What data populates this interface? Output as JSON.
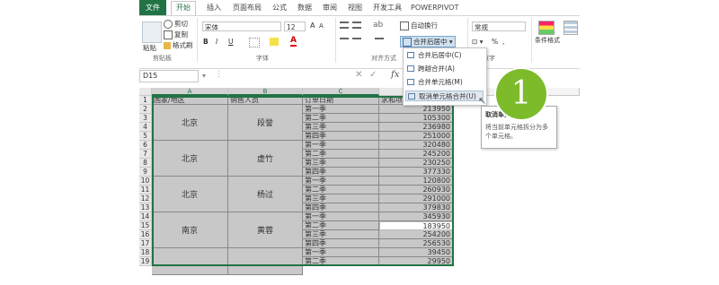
{
  "ribbon_tabs": [
    "文件",
    "开始",
    "插入",
    "页面布局",
    "公式",
    "数据",
    "审阅",
    "视图",
    "开发工具",
    "POWERPIVOT"
  ],
  "clipboard": {
    "paste": "粘贴",
    "cut": "剪切",
    "copy": "复制",
    "format_painter": "格式刷",
    "label": "剪贴板"
  },
  "font": {
    "name": "宋体",
    "size": "12",
    "bold": "B",
    "italic": "I",
    "underline": "U",
    "grow": "A",
    "shrink": "A",
    "label": "字体"
  },
  "alignment": {
    "wrap": "自动换行",
    "merge": "合并后居中",
    "label": "对齐方式"
  },
  "number": {
    "format": "常规",
    "percent": "%",
    "comma": ",",
    "label": "数字"
  },
  "styles": {
    "cond": "条件格式",
    "table": "套用\n表格格式"
  },
  "namebox": "D15",
  "formula_value": "183950",
  "columns": [
    "A",
    "B",
    "C"
  ],
  "headers": [
    "国家/地区",
    "销售人员",
    "订单日期",
    "求和项:订单金额"
  ],
  "groups": [
    {
      "country": "北京",
      "person": "段誉"
    },
    {
      "country": "北京",
      "person": "虚竹"
    },
    {
      "country": "北京",
      "person": "杨过"
    },
    {
      "country": "南京",
      "person": "黄蓉"
    }
  ],
  "quarters": [
    "第一季",
    "第二季",
    "第三季",
    "第四季"
  ],
  "amounts": [
    "213950",
    "105300",
    "236980",
    "251000",
    "320480",
    "245200",
    "230250",
    "377330",
    "120800",
    "260930",
    "291000",
    "379830",
    "345930",
    "183950",
    "254200",
    "256530",
    "39450",
    "29950"
  ],
  "row_numbers": [
    "1",
    "2",
    "3",
    "4",
    "5",
    "6",
    "7",
    "8",
    "9",
    "10",
    "11",
    "12",
    "13",
    "14",
    "15",
    "16",
    "17",
    "18",
    "19"
  ],
  "dropdown": {
    "items": [
      {
        "label": "合并后居中(C)"
      },
      {
        "label": "跨越合并(A)"
      },
      {
        "label": "合并单元格(M)"
      },
      {
        "label": "取消单元格合并(U)"
      }
    ]
  },
  "tooltip": {
    "title": "取消单元格合并",
    "body": "将当前单元格拆分为多个单元格。"
  },
  "step_badge": "1",
  "colors": {
    "excel_green": "#217346",
    "badge": "#7dbb2b",
    "cell_gray": "#c8c8c8"
  }
}
